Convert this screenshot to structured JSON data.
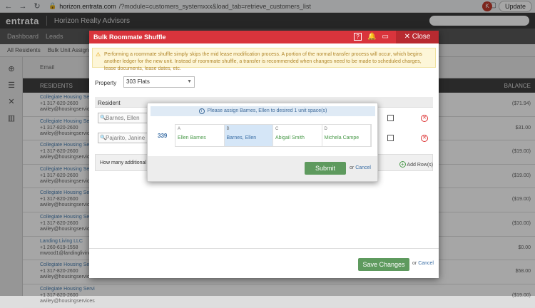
{
  "browser": {
    "url_host": "horizon.entrata.com",
    "url_path": "/?module=customers_systemxxx&load_tab=retrieve_customers_list",
    "profile_initial": "K",
    "update_label": "Update"
  },
  "app": {
    "logo": "entrata",
    "company": "Horizon Realty Advisors",
    "tabs": [
      "Dashboard",
      "Leads"
    ],
    "subtabs": [
      "All Residents",
      "Bulk Unit Assignment"
    ],
    "email_label": "Email"
  },
  "background": {
    "col_residents": "RESIDENTS",
    "col_balance": "BALANCE",
    "rows": [
      {
        "name": "Collegiate Housing Servi",
        "phone": "+1 317-820-2600",
        "email": "awiley@housingservices",
        "balance": "($71.94)"
      },
      {
        "name": "Collegiate Housing Servi",
        "phone": "+1 317-820-2600",
        "email": "awiley@housingservices",
        "balance": "$31.00"
      },
      {
        "name": "Collegiate Housing Servi",
        "phone": "+1 317-820-2600",
        "email": "awiley@housingservices",
        "balance": "($19.00)"
      },
      {
        "name": "Collegiate Housing Servi",
        "phone": "+1 317-820-2600",
        "email": "awiley@housingservices",
        "balance": "($19.00)"
      },
      {
        "name": "Collegiate Housing Servi",
        "phone": "+1 317-820-2600",
        "email": "awiley@housingservices",
        "balance": "($19.00)"
      },
      {
        "name": "Collegiate Housing Servi",
        "phone": "+1 317-820-2600",
        "email": "awiley@housingservices",
        "balance": "($10.00)"
      },
      {
        "name": "Landing Living LLC",
        "phone": "+1 260-619-1558",
        "email": "mwood1@landingliving",
        "balance": "$0.00"
      },
      {
        "name": "Collegiate Housing Servi",
        "phone": "+1 317-820-2600",
        "email": "awiley@housingservices",
        "balance": "$58.00"
      },
      {
        "name": "Collegiate Housing Servi",
        "phone": "+1 317-820-2600",
        "email": "awiley@housingservices",
        "balance": "($19.00)"
      }
    ]
  },
  "modal": {
    "title": "Bulk Roommate Shuffle",
    "close_label": "Close",
    "warning": "Performing a roommate shuffle simply skips the mid lease modification process. A portion of the normal transfer process will occur, which begins another ledger for the new unit. Instead of roommate shuffle, a transfer is recommended when changes need to be made to scheduled charges, lease documents, lease dates, etc.",
    "property_label": "Property",
    "property_value": "303 Flats",
    "resident_header": "Resident",
    "residents": [
      "Barnes, Ellen",
      "Pajarito, Janine"
    ],
    "additional_rows_text": "How many additional ro",
    "add_rows_label": "Add Row(s)",
    "save_label": "Save Changes",
    "or_text": "or",
    "cancel_label": "Cancel"
  },
  "popup": {
    "info": "Please assign Barnes, Ellen to desired 1 unit space(s)",
    "unit": "339",
    "spaces": [
      {
        "letter": "A",
        "occupant": "Ellen Barnes",
        "selected": false
      },
      {
        "letter": "B",
        "occupant": "Barnes, Ellen",
        "selected": true
      },
      {
        "letter": "C",
        "occupant": "Abigail Smith",
        "selected": false
      },
      {
        "letter": "D",
        "occupant": "Michela Campe",
        "selected": false
      }
    ],
    "submit_label": "Submit",
    "or_text": "or",
    "cancel_label": "Cancel"
  }
}
